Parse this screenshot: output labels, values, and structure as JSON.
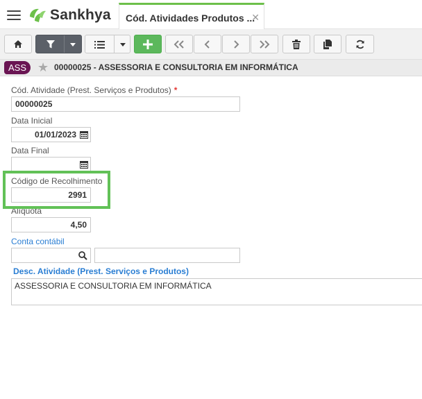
{
  "app": {
    "logo_text": "Sankhya",
    "brand_color": "#6cc04a"
  },
  "tab": {
    "title": "Cód. Atividades Produtos ...",
    "close_glyph": "✕"
  },
  "toolbar": {
    "buttons": [
      "home-icon",
      "filter-icon",
      "chevron-down-icon",
      "list-icon",
      "chevron-down-icon",
      "plus-icon",
      "first-icon",
      "prev-icon",
      "next-icon",
      "last-icon",
      "trash-icon",
      "copy-icon",
      "refresh-icon"
    ]
  },
  "record": {
    "badge": "ASS",
    "title": "00000025 - ASSESSORIA E CONSULTORIA EM INFORMÁTICA"
  },
  "form": {
    "cod_atividade": {
      "label": "Cód. Atividade (Prest. Serviços e Produtos)",
      "required_mark": "*",
      "value": "00000025"
    },
    "data_inicial": {
      "label": "Data Inicial",
      "value": "01/01/2023"
    },
    "data_final": {
      "label": "Data Final",
      "value": ""
    },
    "codigo_recolhimento": {
      "label": "Código de Recolhimento",
      "value": "2991"
    },
    "aliquota": {
      "label": "Alíquota",
      "value": "4,50"
    },
    "conta_contabil": {
      "label": "Conta contábil",
      "code": "",
      "description": ""
    },
    "desc_atividade": {
      "label": "Desc. Atividade (Prest. Serviços e Produtos)",
      "value": "ASSESSORIA E CONSULTORIA EM INFORMÁTICA"
    }
  }
}
